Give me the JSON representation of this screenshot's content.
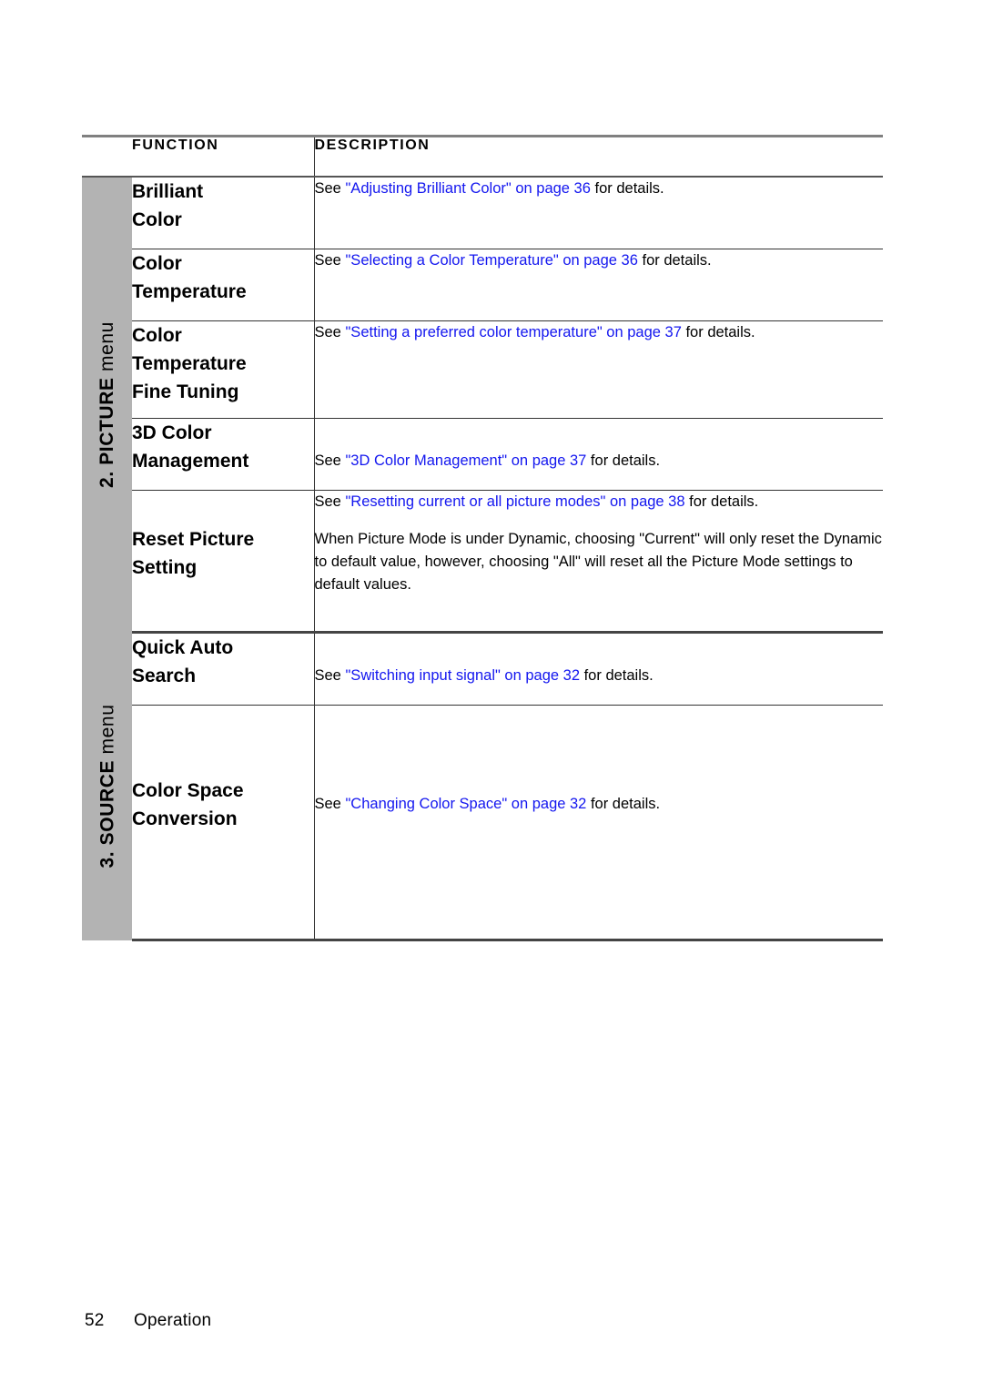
{
  "document": {
    "footer": {
      "page_number": "52",
      "section": "Operation"
    }
  },
  "table": {
    "headers": {
      "function": "FUNCTION",
      "description": "DESCRIPTION"
    },
    "sections": [
      {
        "label_prefix": "2. PICTURE",
        "label_suffix": " menu",
        "rows": [
          {
            "function": "Brilliant\nColor",
            "function_line1": "Brilliant",
            "function_line2": "Color",
            "paragraphs": [
              {
                "before": "See ",
                "link": "\"Adjusting Brilliant Color\" on page 36",
                "after": " for details."
              }
            ]
          },
          {
            "function_line1": "Color",
            "function_line2": "Temperature",
            "paragraphs": [
              {
                "before": "See ",
                "link": "\"Selecting a Color Temperature\" on page 36",
                "after": " for details."
              }
            ]
          },
          {
            "function_line1": "Color",
            "function_line2": "Temperature",
            "function_line3": "Fine Tuning",
            "paragraphs": [
              {
                "before": "See ",
                "link": "\"Setting a preferred color temperature\" on page 37",
                "after": " for details."
              }
            ]
          },
          {
            "function_line1": "3D Color",
            "function_line2": "Management",
            "paragraphs": [
              {
                "before": "See ",
                "link": "\"3D Color Management\" on page 37",
                "after": " for details."
              }
            ]
          },
          {
            "function_line1": "Reset Picture",
            "function_line2": "Setting",
            "paragraphs": [
              {
                "before": "See ",
                "link": "\"Resetting current or all picture modes\" on page 38",
                "after": " for details."
              },
              {
                "before": "When Picture Mode is under Dynamic, choosing \"Current\" will only reset the Dynamic to default value, however, choosing \"All\" will reset all the Picture Mode settings to default values.",
                "link": "",
                "after": ""
              }
            ]
          }
        ]
      },
      {
        "label_prefix": "3. SOURCE",
        "label_suffix": " menu",
        "rows": [
          {
            "function_line1": "Quick Auto",
            "function_line2": "Search",
            "paragraphs": [
              {
                "before": "See ",
                "link": "\"Switching input signal\" on page 32",
                "after": " for details."
              }
            ]
          },
          {
            "function_line1": "Color Space",
            "function_line2": "Conversion",
            "paragraphs": [
              {
                "before": "See ",
                "link": "\"Changing Color Space\" on page 32",
                "after": " for details."
              }
            ]
          }
        ]
      }
    ]
  },
  "colors": {
    "link": "#1417ef",
    "sidebar_gray": "#b3b3b3",
    "rule": "#333333"
  }
}
